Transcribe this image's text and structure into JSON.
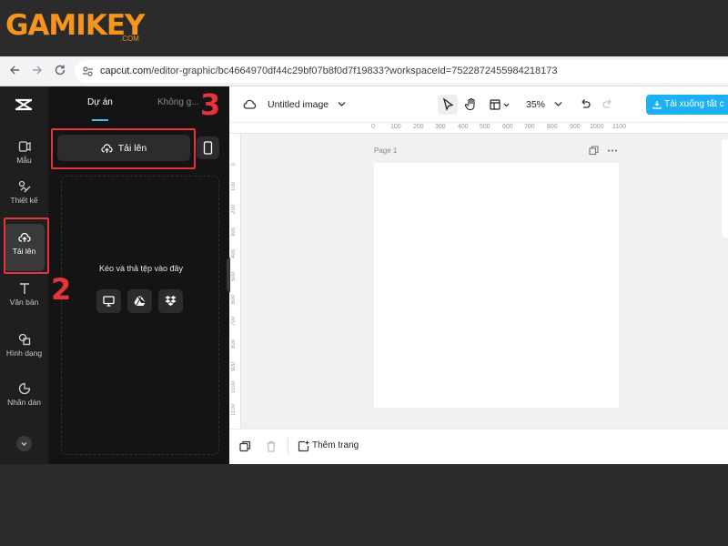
{
  "brand": {
    "logo_text": "GAMIKEY",
    "domain_suffix": ".COM",
    "color": "#f7941d"
  },
  "browser": {
    "url_host": "capcut.com",
    "url_path": "/editor-graphic/bc4664970df44c29bf07b8f0d7f19833?workspaceId=7522872455984218173"
  },
  "rail": {
    "items": [
      {
        "label": "Mẫu",
        "icon": "template-icon"
      },
      {
        "label": "Thiết kế",
        "icon": "design-icon"
      },
      {
        "label": "Tải lên",
        "icon": "cloud-upload-icon"
      },
      {
        "label": "Văn bản",
        "icon": "text-icon"
      },
      {
        "label": "Hình dạng",
        "icon": "shapes-icon"
      },
      {
        "label": "Nhãn dán",
        "icon": "sticker-icon"
      }
    ],
    "active_index": 2
  },
  "panel": {
    "tabs": [
      "Dự án",
      "Không g..."
    ],
    "upload_label": "Tải lên",
    "drop_text": "Kéo và thả tệp vào đây",
    "sources": [
      "computer-icon",
      "google-drive-icon",
      "dropbox-icon"
    ]
  },
  "toolbar": {
    "doc_title": "Untitled image",
    "zoom": "35%",
    "download_label": "Tải xuống tất c"
  },
  "canvas": {
    "page_label": "Page 1",
    "ruler_top": [
      "0",
      "100",
      "200",
      "300",
      "400",
      "500",
      "600",
      "700",
      "800",
      "900",
      "1000",
      "1100"
    ],
    "ruler_left": [
      "0",
      "100",
      "200",
      "300",
      "400",
      "500",
      "600",
      "700",
      "800",
      "900",
      "1000",
      "1100"
    ]
  },
  "bottom": {
    "add_page": "Thêm trang"
  },
  "annotations": {
    "n2": "2",
    "n3": "3",
    "color": "#e8333a"
  }
}
